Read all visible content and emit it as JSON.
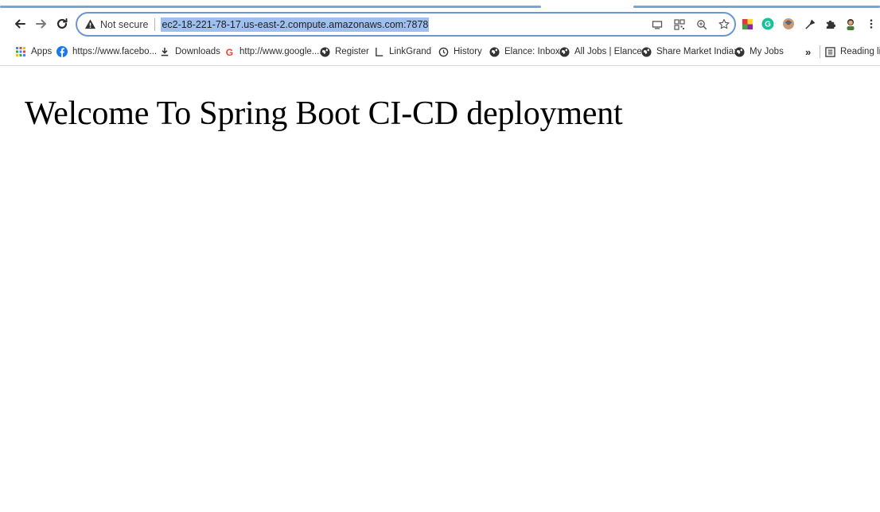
{
  "browser": {
    "security_label": "Not secure",
    "url": "ec2-18-221-78-17.us-east-2.compute.amazonaws.com:7878",
    "accent_color": "#6d96d1",
    "url_highlight_color": "#9fc0ef"
  },
  "bookmarks": {
    "apps": "Apps",
    "facebook": "https://www.facebo...",
    "downloads": "Downloads",
    "google": "http://www.google....",
    "register": "Register",
    "linkgrand": "LinkGrand",
    "history": "History",
    "elance_inbox": "Elance: Inbox",
    "all_jobs": "All Jobs | Elance",
    "share_market": "Share Market India:...",
    "my_jobs": "My Jobs",
    "overflow": "»",
    "reading_list": "Reading list"
  },
  "page": {
    "heading": "Welcome To Spring Boot CI-CD deployment"
  }
}
